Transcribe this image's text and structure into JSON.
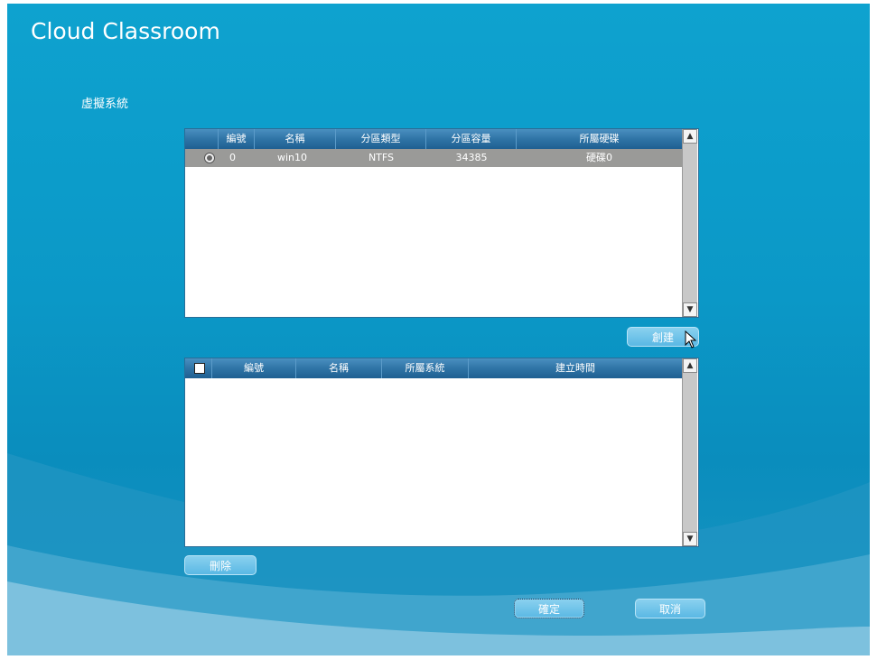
{
  "app": {
    "title": "Cloud Classroom"
  },
  "section": {
    "title": "虛擬系統"
  },
  "systems_table": {
    "headers": [
      "編號",
      "名稱",
      "分區類型",
      "分區容量",
      "所屬硬碟"
    ],
    "rows": [
      {
        "id": "0",
        "name": "win10",
        "type": "NTFS",
        "capacity": "34385",
        "disk": "硬碟0"
      }
    ]
  },
  "create_button": {
    "label": "創建"
  },
  "snapshots_table": {
    "headers": [
      "編號",
      "名稱",
      "所屬系統",
      "建立時間"
    ],
    "rows": []
  },
  "delete_button": {
    "label": "刪除"
  },
  "ok_button": {
    "label": "確定"
  },
  "cancel_button": {
    "label": "取消"
  },
  "icons": {
    "scroll_up": "chevron-up-icon",
    "scroll_down": "chevron-down-icon",
    "cursor": "mouse-pointer-icon"
  },
  "colors": {
    "background": "#0ea2cf",
    "table_header": "#2f74a6",
    "selected_row": "#9a9a98",
    "button": "#6cc3ea"
  }
}
